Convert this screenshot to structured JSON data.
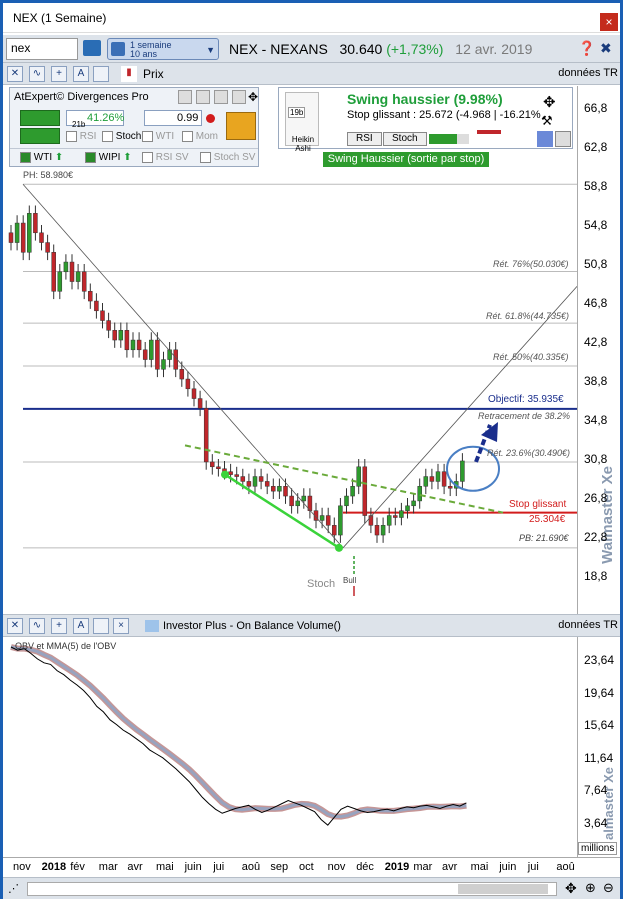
{
  "window": {
    "title": "NEX (1 Semaine)",
    "close": "×"
  },
  "toolbar": {
    "search_value": "nex",
    "period_line1": "1 semaine",
    "period_line2": "10 ans",
    "ticker_name": "NEX - NEXANS",
    "price": "30.640",
    "change": "(+1,73%)",
    "date": "12 avr. 2019"
  },
  "toolbar2": {
    "prix_label": "Prix",
    "donnees_label": "données TR"
  },
  "indicator_panel": {
    "title": "AtExpert© Divergences Pro",
    "pct": "41.26%",
    "weeks": "21b",
    "ratio": "0.99",
    "checks": [
      "RSI",
      "Stoch",
      "WTI",
      "Mom"
    ],
    "row3": [
      "WTI",
      "WIPI",
      "RSI SV",
      "Stoch SV"
    ]
  },
  "swing": {
    "title": "Swing haussier (9.98%)",
    "stop_text": "Stop glissant : 25.672",
    "stop_delta": "(-4.968 | -16.21%",
    "btn_rsi": "RSI",
    "btn_stoch": "Stoch",
    "badge": "Swing Haussier (sortie par stop)",
    "heikin": "Heikin Ashi",
    "heikin_period": "19b"
  },
  "annotations": {
    "ph": "PH: 58.980€",
    "pb": "PB: 21.690€",
    "ret76": "Rét. 76%(50.030€)",
    "ret618": "Rét. 61.8%(44.735€)",
    "ret50": "Rét. 50%(40.335€)",
    "ret382": "Retracement de 38.2%",
    "ret236": "Rét. 23.6%(30.490€)",
    "objectif": "Objectif: 35.935€",
    "stop_label": "Stop glissant",
    "stop_value": "25.304€",
    "stoch": "Stoch",
    "bull": "Bull"
  },
  "yaxis": [
    "66,8",
    "62,8",
    "58,8",
    "54,8",
    "50,8",
    "46,8",
    "42,8",
    "38,8",
    "34,8",
    "30,8",
    "26,8",
    "22,8",
    "18,8"
  ],
  "watermark": "Walmaster Xe",
  "divider": {
    "label": "Investor Plus - On Balance Volume()",
    "donnees": "données TR"
  },
  "obv": {
    "legend": "OBV et MMA(5) de l'OBV",
    "yaxis": [
      "23,64",
      "19,64",
      "15,64",
      "11,64",
      "7,64",
      "3,64"
    ],
    "millions": "millions",
    "watermark": "almaster Xe"
  },
  "xaxis": [
    {
      "t": "nov",
      "b": false
    },
    {
      "t": "2018",
      "b": true
    },
    {
      "t": "fév",
      "b": false
    },
    {
      "t": "mar",
      "b": false
    },
    {
      "t": "avr",
      "b": false
    },
    {
      "t": "mai",
      "b": false
    },
    {
      "t": "juin",
      "b": false
    },
    {
      "t": "jui",
      "b": false
    },
    {
      "t": "aoû",
      "b": false
    },
    {
      "t": "sep",
      "b": false
    },
    {
      "t": "oct",
      "b": false
    },
    {
      "t": "nov",
      "b": false
    },
    {
      "t": "déc",
      "b": false
    },
    {
      "t": "2019",
      "b": true
    },
    {
      "t": "mar",
      "b": false
    },
    {
      "t": "avr",
      "b": false
    },
    {
      "t": "mai",
      "b": false
    },
    {
      "t": "juin",
      "b": false
    },
    {
      "t": "jui",
      "b": false
    },
    {
      "t": "aoû",
      "b": false
    }
  ],
  "colors": {
    "up": "#2e9b2e",
    "down": "#c0262b",
    "objective": "#1a2e8c",
    "stop": "#d21c1c"
  }
}
